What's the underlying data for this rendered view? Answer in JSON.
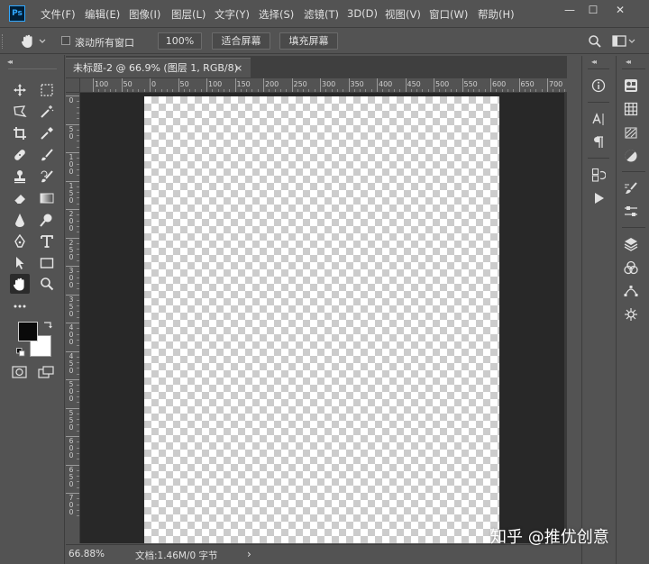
{
  "app": {
    "logo": "Ps"
  },
  "menu": [
    "文件(F)",
    "编辑(E)",
    "图像(I)",
    "图层(L)",
    "文字(Y)",
    "选择(S)",
    "滤镜(T)",
    "3D(D)",
    "视图(V)",
    "窗口(W)",
    "帮助(H)"
  ],
  "window_controls": {
    "minimize": "—",
    "maximize": "☐",
    "close": "✕"
  },
  "options": {
    "scroll_all_windows": "滚动所有窗口",
    "scroll_all_checked": false,
    "zoom_value": "100%",
    "fit_screen": "适合屏幕",
    "fill_screen": "填充屏幕"
  },
  "document": {
    "tab_title": "未标题-2 @ 66.9% (图层 1, RGB/8)",
    "tab_close": "×",
    "ruler_top": [
      "100",
      "50",
      "0",
      "50",
      "100",
      "150",
      "200",
      "250",
      "300",
      "350",
      "400",
      "450",
      "500",
      "550",
      "600",
      "650",
      "700"
    ],
    "ruler_left": [
      "0",
      "50",
      "100",
      "150",
      "200",
      "250",
      "300",
      "350",
      "400",
      "450",
      "500",
      "550",
      "600",
      "650",
      "700"
    ]
  },
  "status": {
    "zoom": "66.88%",
    "doc_info": "文档:1.46M/0 字节",
    "arrow": "›"
  },
  "colors": {
    "foreground": "#0a0a0a",
    "background": "#ffffff",
    "ui_bg": "#535353",
    "pasteboard": "#282828"
  },
  "panels_collapse": "◂◂",
  "watermark": "知乎 @推优创意"
}
